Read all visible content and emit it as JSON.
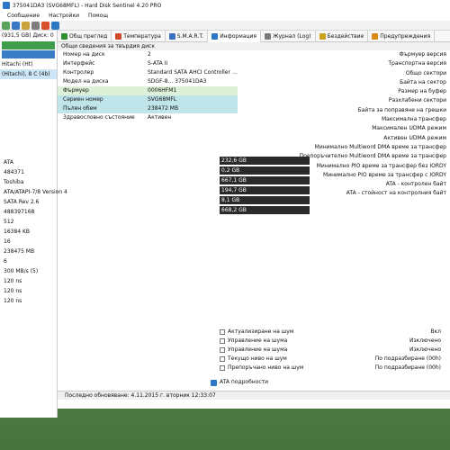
{
  "window": {
    "title": "375041DA3 (SVG68MFL) - Hard Disk Sentinel 4.20 PRO"
  },
  "menu": [
    "Сообщение",
    "Настройки",
    "Помощ"
  ],
  "tabs": [
    {
      "label": "Общ преглед",
      "icon": "overview-icon",
      "color": "#2f8f2f"
    },
    {
      "label": "Температура",
      "icon": "thermometer-icon",
      "color": "#d04a2a"
    },
    {
      "label": "S.M.A.R.T.",
      "icon": "smart-icon",
      "color": "#3a6fbf"
    },
    {
      "label": "Информация",
      "icon": "info-icon",
      "color": "#2b78c5"
    },
    {
      "label": "Журнал (Log)",
      "icon": "log-icon",
      "color": "#7a7a7a"
    },
    {
      "label": "Бездействие",
      "icon": "power-icon",
      "color": "#c8a21b"
    },
    {
      "label": "Предупреждения",
      "icon": "warning-icon",
      "color": "#d98a14"
    }
  ],
  "left_panel": {
    "disks": [
      {
        "label": "(931,5 GB)  Диск: 0",
        "selected": false
      },
      {
        "label": "Hitachi (Ht)",
        "selected": false
      },
      {
        "label": "(Hitachi), 8 C (4b)",
        "selected": true
      }
    ]
  },
  "section": {
    "title": "Общи сведения за твърдия диск"
  },
  "info_rows": [
    {
      "label": "Номер на диск",
      "value": "2",
      "hl": ""
    },
    {
      "label": "Интерфейс",
      "value": "S-ATA II",
      "hl": ""
    },
    {
      "label": "Контролер",
      "value": "Standard SATA AHCI Controller (AHCI)",
      "hl": ""
    },
    {
      "label": "Модел на диска",
      "value": "SDGF-8... 375041DA3",
      "hl": ""
    },
    {
      "label": "Фърмуер",
      "value": "0006HFM1",
      "hl": "hl"
    },
    {
      "label": "Сериен номер",
      "value": "SVG68MFL",
      "hl": "hl2"
    },
    {
      "label": "Пълен обем",
      "value": "238472 MB",
      "hl": "hl2"
    },
    {
      "label": "Здравословно състояние",
      "value": "Активен",
      "hl": ""
    }
  ],
  "left_values": [
    "ATA",
    "484371",
    "Toshiba",
    "ATA/ATAPI-7/8 Version 4",
    "SATA Rev 2.6",
    "488397168",
    "512",
    "16384 KB",
    "16",
    "238475 MB",
    "6",
    "300 MB/s (5)",
    "120 ns",
    "120 ns",
    "120 ns"
  ],
  "partition_bars": [
    {
      "label": "232,6 GB",
      "side": "Диск 1"
    },
    {
      "label": "0,2 GB",
      "side": "Диск 1"
    },
    {
      "label": "667,1 GB",
      "side": "Диск 0"
    },
    {
      "label": "194,7 GB",
      "side": "Диск 0"
    },
    {
      "label": "8,1 GB",
      "side": "Диск 0"
    },
    {
      "label": "668,2 GB",
      "side": "Диск 1"
    }
  ],
  "props": [
    "Фърмуер версия",
    "Транспортна версия",
    "Общо сектори",
    "Байта на сектор",
    "Размер на буфер",
    "Разхлабени сектори",
    "Байта за поправяне на грешки",
    "Максимална трансфер",
    "Максимален UDMA режим",
    "Активен UDMA режим",
    "Минимално Multiword DMA време за трансфер",
    "Препоръчително Multiword DMA време за трансфер",
    "Минимално PIO време за трансфер без IORDY",
    "Минимално PIO време за трансфер с IORDY",
    "ATA - контролен байт",
    "ATA - стойност на контролния байт"
  ],
  "features": [
    {
      "label": "Актуализиране на шум",
      "value": "Вкл"
    },
    {
      "label": "Управление на шума",
      "value": "Изключено"
    },
    {
      "label": "Управление на шума",
      "value": "Изключено"
    },
    {
      "label": "Текущо ниво на шум",
      "value": "По подразбиране (00h)"
    },
    {
      "label": "Препоръчано ниво на шум",
      "value": "По подразбиране (00h)"
    }
  ],
  "ata_details": "ATA подробности",
  "status": "Последно обновяване: 4.11.2015 г. вторник 12:33:07"
}
